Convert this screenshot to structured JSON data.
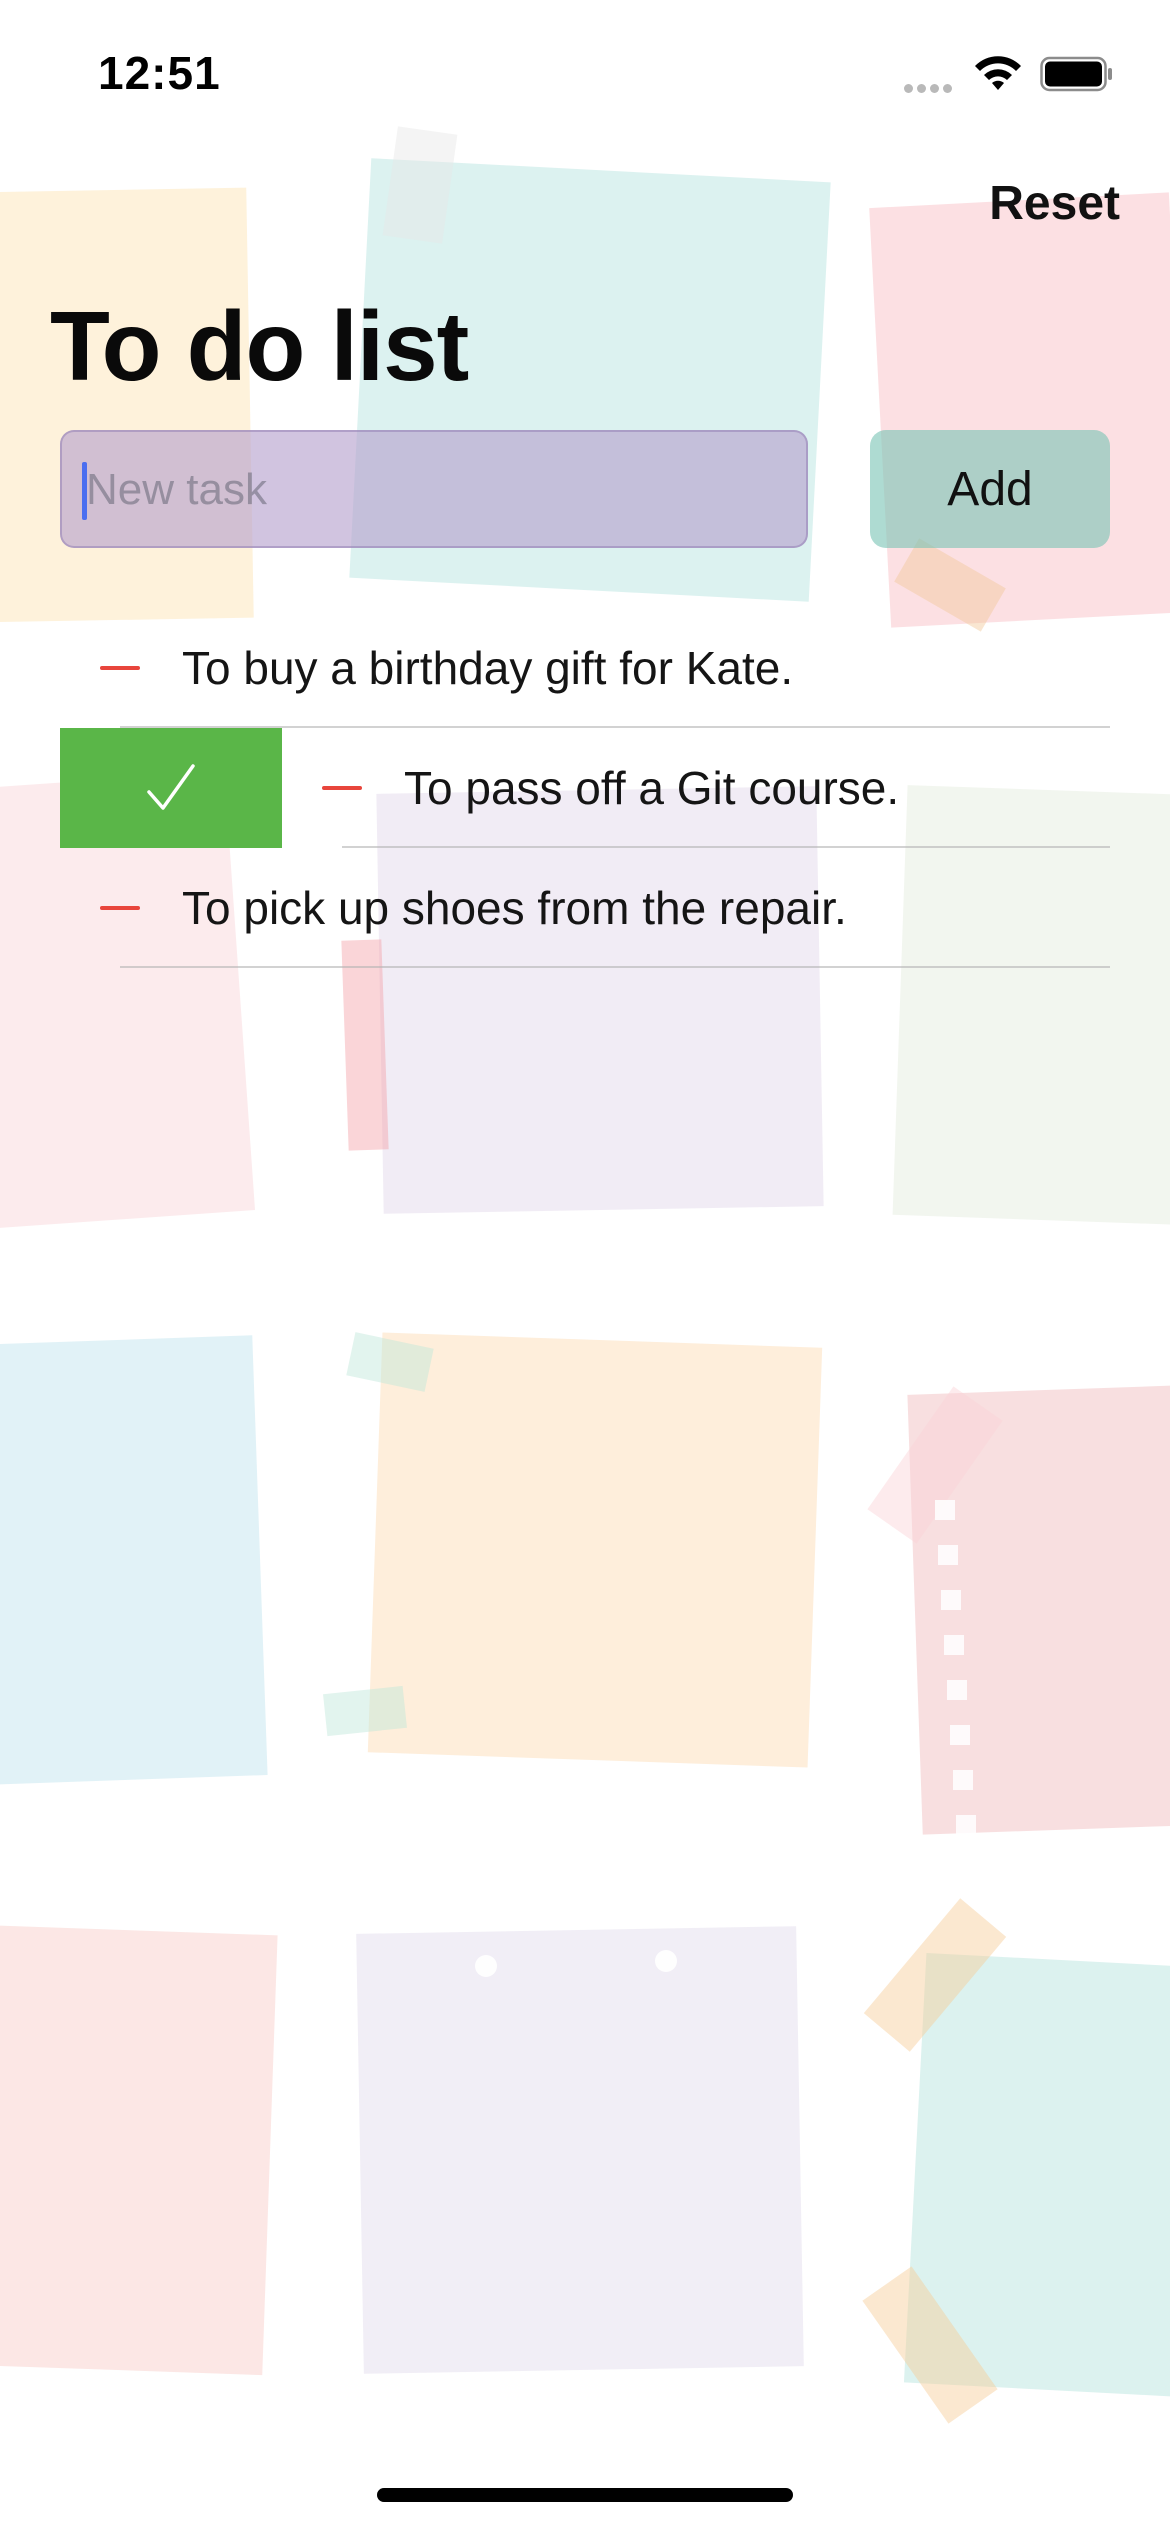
{
  "status_bar": {
    "time": "12:51",
    "signal_icon": "signal-dots-icon",
    "wifi_icon": "wifi-icon",
    "battery_icon": "battery-full-icon"
  },
  "nav": {
    "reset_label": "Reset"
  },
  "header": {
    "title": "To do list"
  },
  "new_task": {
    "placeholder": "New task",
    "value": "",
    "add_label": "Add"
  },
  "tasks": [
    {
      "label": "To buy a birthday gift for Kate.",
      "swiped": false
    },
    {
      "label": "To pass off a Git course.",
      "swiped": true,
      "swipe_action_icon": "checkmark-icon"
    },
    {
      "label": "To pick up shoes from the repair.",
      "swiped": false
    }
  ],
  "colors": {
    "delete_red": "#e8453c",
    "swipe_done_green": "#5ab648",
    "input_fill": "#b4a0cd",
    "add_button_fill": "#78c3b4",
    "caret_blue": "#4a6ef0"
  }
}
